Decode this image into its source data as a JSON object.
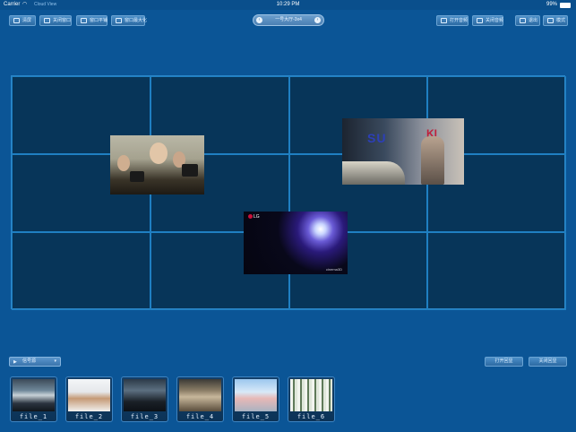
{
  "status_bar": {
    "carrier": "Carrier",
    "wifi_icon": "wifi-icon",
    "app_name": "Cloud View",
    "time": "10:29 PM",
    "battery_percent": "99%",
    "battery_level": 0.99
  },
  "toolbar": {
    "left_buttons": [
      {
        "label": "清屏",
        "icon": "clear-screen-icon"
      },
      {
        "label": "关闭窗口",
        "icon": "close-window-icon"
      },
      {
        "label": "窗口平铺",
        "icon": "tile-windows-icon"
      },
      {
        "label": "窗口最大化",
        "icon": "maximize-window-icon"
      }
    ],
    "mode_select": {
      "label": "一号大厅-3x4",
      "prev_icon": "chevron-left-icon",
      "next_icon": "chevron-right-icon"
    },
    "right_buttons": [
      {
        "label": "打开音频",
        "icon": "open-audio-icon"
      },
      {
        "label": "关闭音频",
        "icon": "close-audio-icon"
      },
      {
        "label": "退出",
        "icon": "exit-icon"
      },
      {
        "label": "模式",
        "icon": "mode-grid-icon"
      }
    ]
  },
  "video_wall": {
    "rows": 3,
    "columns": 4,
    "windows": [
      {
        "name": "window-photographers",
        "content": "photographers-scene"
      },
      {
        "name": "window-suzuki",
        "content": "suzuki-show-scene"
      },
      {
        "name": "window-lg",
        "content": "lg-space-scene",
        "logo": "LG",
        "brand": "cinema3D"
      }
    ],
    "suzuki_logo": "SU",
    "suzuki_logo_tail": "KI"
  },
  "bottom_bar": {
    "source_select": {
      "label": "信号源",
      "icon": "play-icon",
      "chevron": "▾"
    },
    "buttons": [
      {
        "label": "打开回显"
      },
      {
        "label": "关闭回显"
      }
    ]
  },
  "files": [
    {
      "label": "file_1",
      "scene": "tunnel"
    },
    {
      "label": "file_2",
      "scene": "people"
    },
    {
      "label": "file_3",
      "scene": "dancer"
    },
    {
      "label": "file_4",
      "scene": "landscape"
    },
    {
      "label": "file_5",
      "scene": "cityscape"
    },
    {
      "label": "file_6",
      "scene": "forest"
    }
  ],
  "colors": {
    "background": "#0b5596",
    "wall_background": "#073559",
    "grid_line": "#1f7fc2",
    "button_top": "#4c8fc8",
    "button_bottom": "#2c6aa3"
  }
}
